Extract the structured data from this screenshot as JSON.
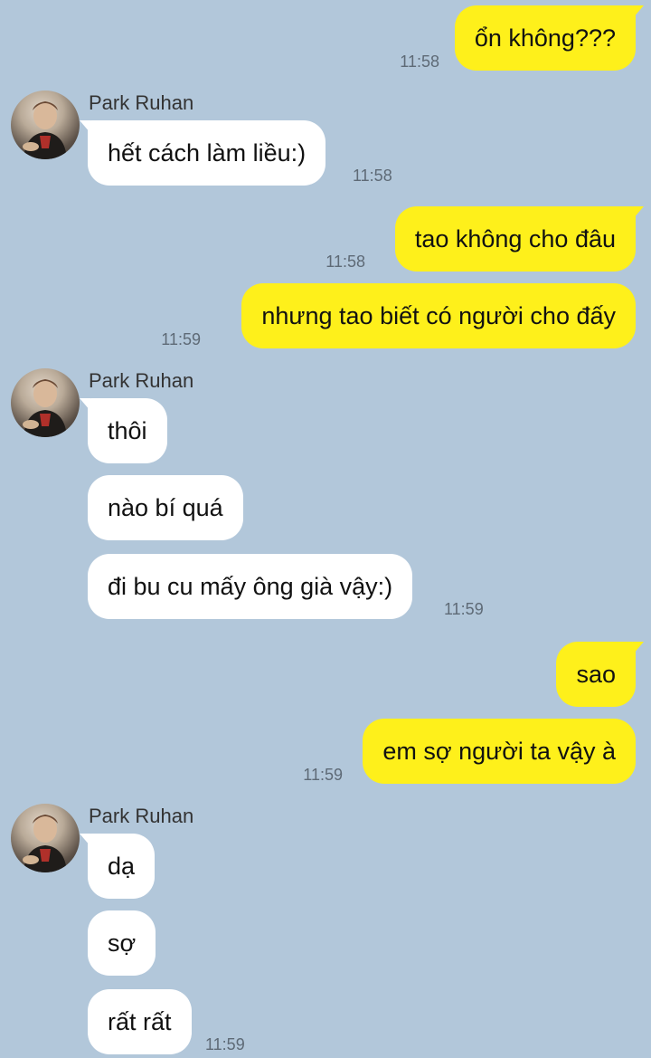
{
  "colors": {
    "background": "#b2c7da",
    "outgoing_bubble": "#fef01b",
    "incoming_bubble": "#ffffff",
    "timestamp": "#5e6a76"
  },
  "messages": [
    {
      "text": "ổn không???",
      "time": "11:58"
    },
    {
      "sender": "Park Ruhan",
      "text": "hết cách làm liều:)",
      "time": "11:58"
    },
    {
      "text": "tao không cho đâu",
      "time": "11:58"
    },
    {
      "text": "nhưng tao biết có người cho đấy",
      "time": "11:59"
    },
    {
      "sender": "Park Ruhan",
      "text": "thôi"
    },
    {
      "text": "nào bí quá"
    },
    {
      "text": "đi bu cu mấy ông già vậy:)",
      "time": "11:59"
    },
    {
      "text": "sao"
    },
    {
      "text": "em sợ người ta vậy à",
      "time": "11:59"
    },
    {
      "sender": "Park Ruhan",
      "text": "dạ"
    },
    {
      "text": "sợ"
    },
    {
      "text": "rất rất",
      "time": "11:59"
    }
  ]
}
